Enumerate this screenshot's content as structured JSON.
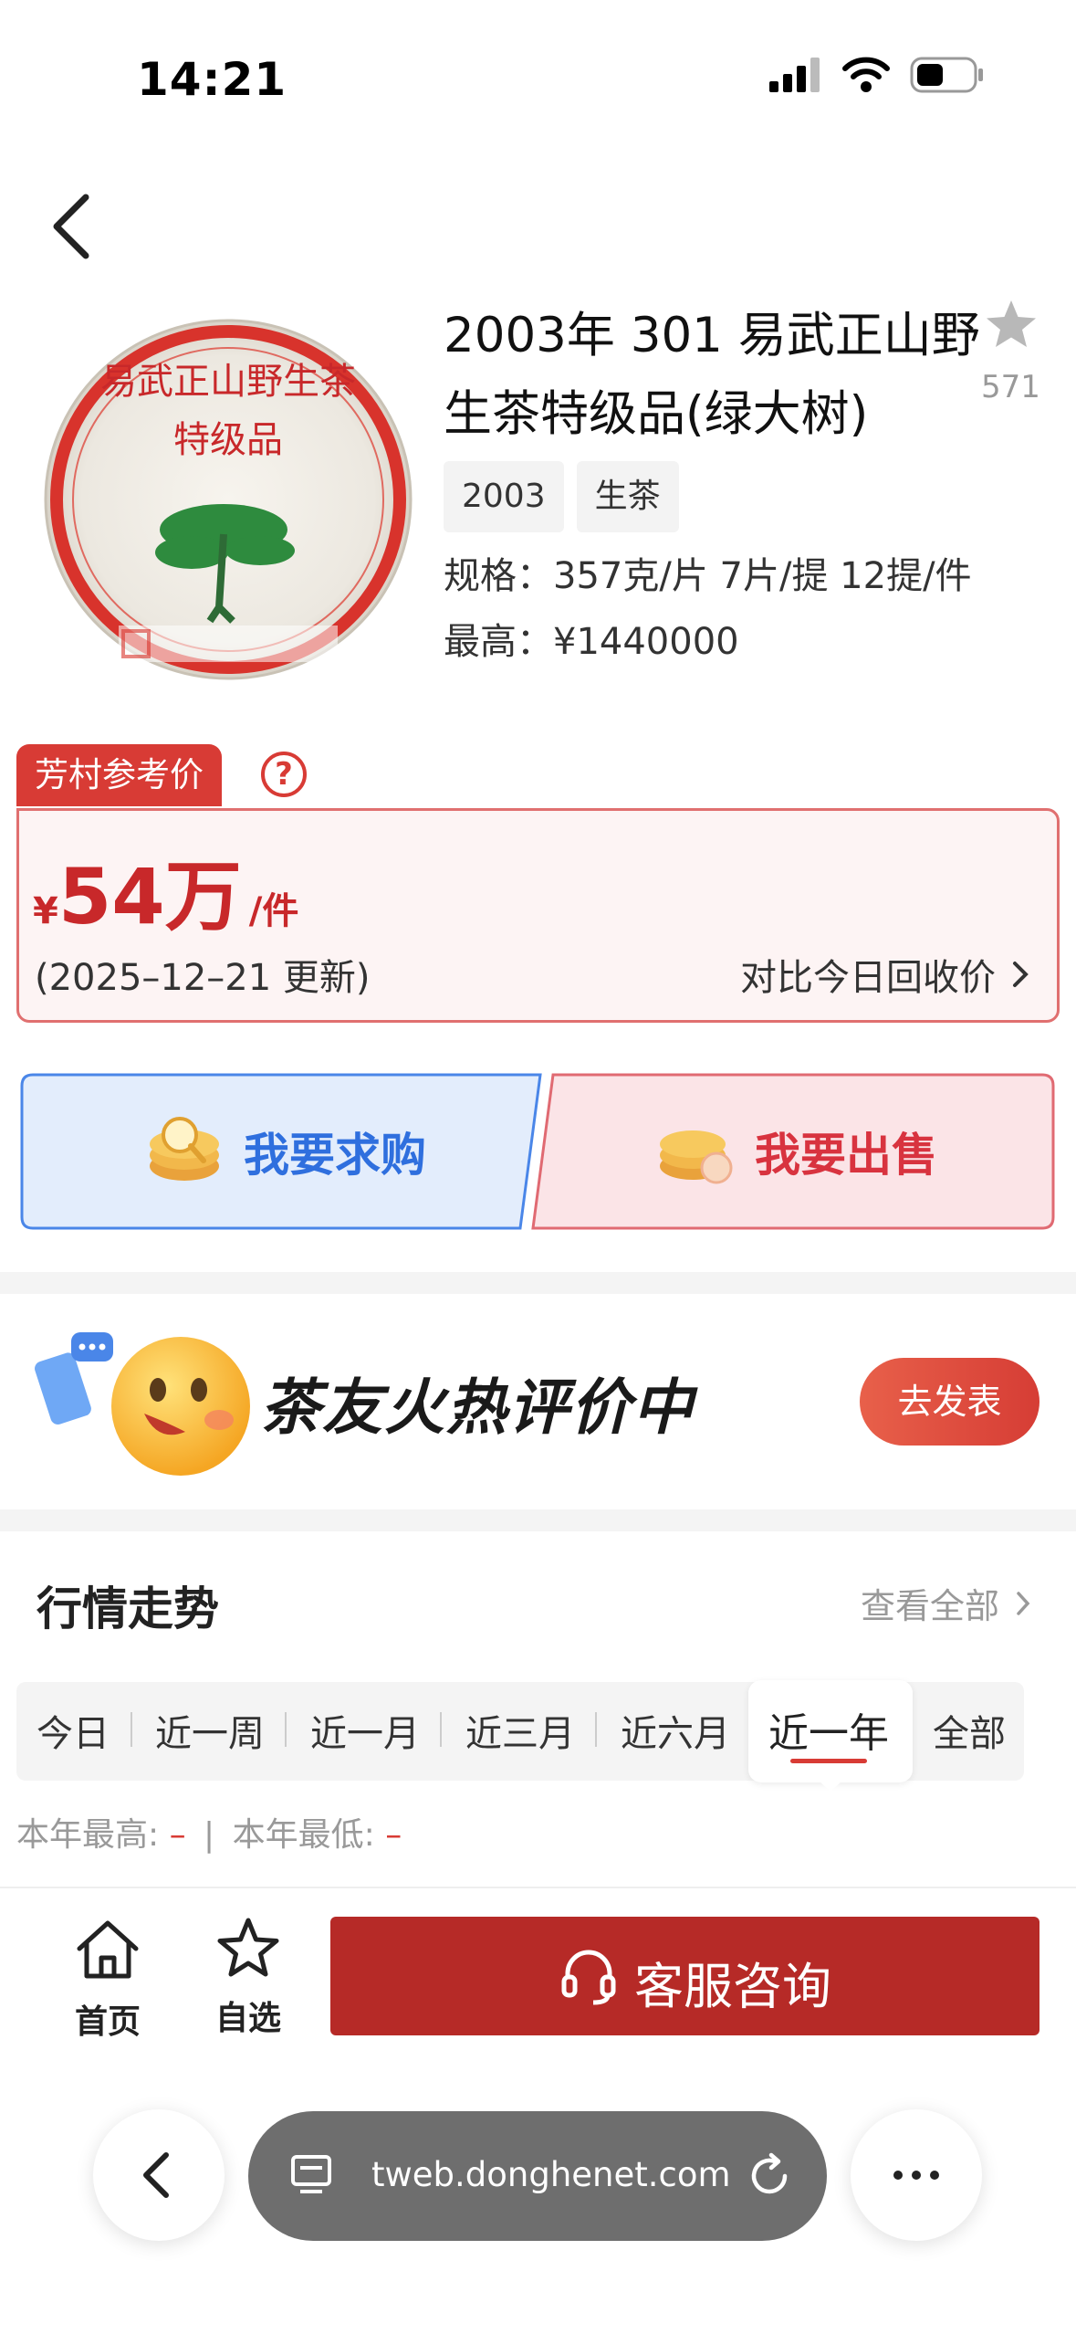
{
  "status_bar": {
    "time": "14:21"
  },
  "product": {
    "title": "2003年 301 易武正山野生茶特级品(绿大树)",
    "favorite_count": "571",
    "tags": [
      "2003",
      "生茶"
    ],
    "spec": "规格：357克/片 7片/提 12提/件",
    "max_price": "最高：¥1440000",
    "image_alt_texts": [
      "易武正山野生茶",
      "特级品"
    ]
  },
  "reference_price": {
    "label": "芳村参考价",
    "help": "?",
    "currency": "¥",
    "amount": "54万",
    "unit": "/件",
    "update": "(2025–12–21 更新)",
    "compare": "对比今日回收价"
  },
  "actions": {
    "buy": "我要求购",
    "sell": "我要出售"
  },
  "promo": {
    "text": "茶友火热评价中",
    "button": "去发表"
  },
  "market": {
    "title": "行情走势",
    "view_all": "查看全部",
    "tabs": [
      "今日",
      "近一周",
      "近一月",
      "近三月",
      "近六月",
      "近一年",
      "全部"
    ],
    "active_tab": "近一年",
    "year_high_label": "本年最高:",
    "year_high_value": "–",
    "sep": "|",
    "year_low_label": "本年最低:",
    "year_low_value": "–"
  },
  "bottom_nav": {
    "home": "首页",
    "watchlist": "自选",
    "service": "客服咨询"
  },
  "browser": {
    "url": "tweb.donghenet.com"
  },
  "colors": {
    "accent": "#c8282a",
    "buy_bg": "#e3edfc",
    "sell_bg": "#fbe4e7",
    "service": "#b62a27"
  }
}
